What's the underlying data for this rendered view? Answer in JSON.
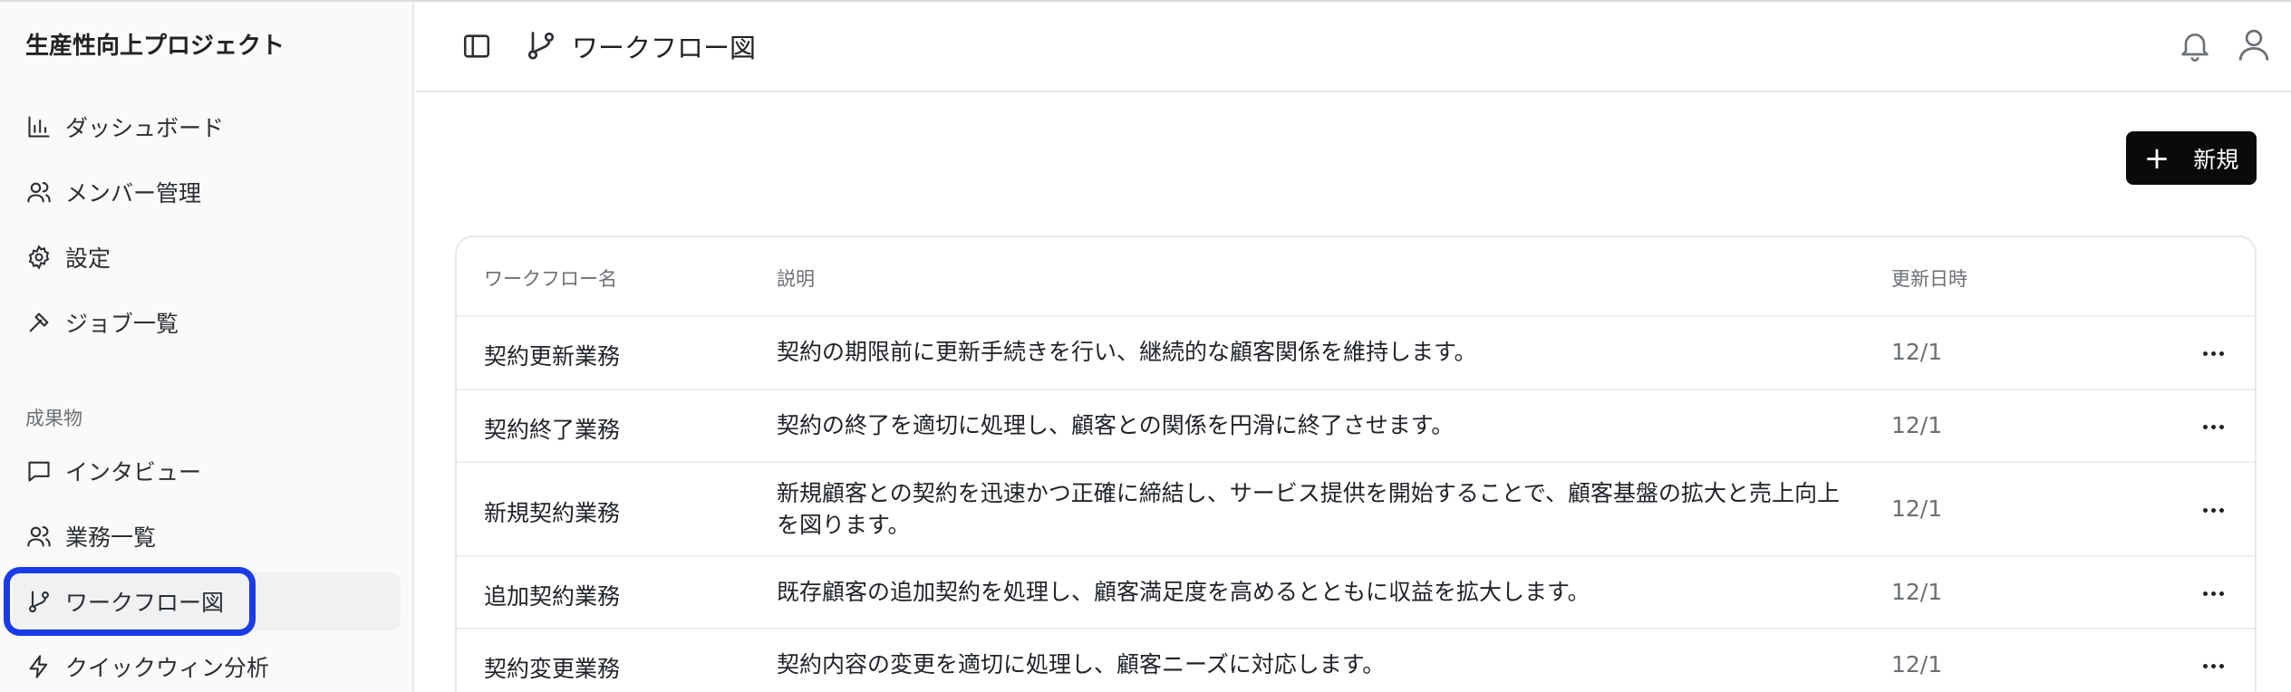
{
  "sidebar": {
    "project_title": "生産性向上プロジェクト",
    "items": [
      {
        "label": "ダッシュボード",
        "icon": "chart-bar-icon"
      },
      {
        "label": "メンバー管理",
        "icon": "users-icon"
      },
      {
        "label": "設定",
        "icon": "gear-icon"
      },
      {
        "label": "ジョブ一覧",
        "icon": "hammer-icon"
      }
    ],
    "section_label": "成果物",
    "section_items": [
      {
        "label": "インタビュー",
        "icon": "message-square-icon"
      },
      {
        "label": "業務一覧",
        "icon": "users-icon"
      },
      {
        "label": "ワークフロー図",
        "icon": "git-branch-icon",
        "active": true
      },
      {
        "label": "クイックウィン分析",
        "icon": "zap-icon"
      }
    ]
  },
  "header": {
    "title": "ワークフロー図",
    "icons": [
      "sidebar-toggle-icon",
      "git-branch-icon",
      "bell-icon",
      "user-icon"
    ]
  },
  "toolbar": {
    "new_button_label": "新規",
    "new_button_icon": "plus-icon"
  },
  "table": {
    "columns": [
      "ワークフロー名",
      "説明",
      "更新日時"
    ],
    "rows": [
      {
        "name": "契約更新業務",
        "description": "契約の期限前に更新手続きを行い、継続的な顧客関係を維持します。",
        "updated": "12/1"
      },
      {
        "name": "契約終了業務",
        "description": "契約の終了を適切に処理し、顧客との関係を円滑に終了させます。",
        "updated": "12/1"
      },
      {
        "name": "新規契約業務",
        "description": "新規顧客との契約を迅速かつ正確に締結し、サービス提供を開始することで、顧客基盤の拡大と売上向上を図ります。",
        "updated": "12/1"
      },
      {
        "name": "追加契約業務",
        "description": "既存顧客の追加契約を処理し、顧客満足度を高めるとともに収益を拡大します。",
        "updated": "12/1"
      },
      {
        "name": "契約変更業務",
        "description": "契約内容の変更を適切に処理し、顧客ニーズに対応します。",
        "updated": "12/1"
      }
    ]
  },
  "colors": {
    "active_highlight": "#1a3be6",
    "primary_button": "#0a0a0a",
    "sidebar_bg": "#fafafa"
  }
}
